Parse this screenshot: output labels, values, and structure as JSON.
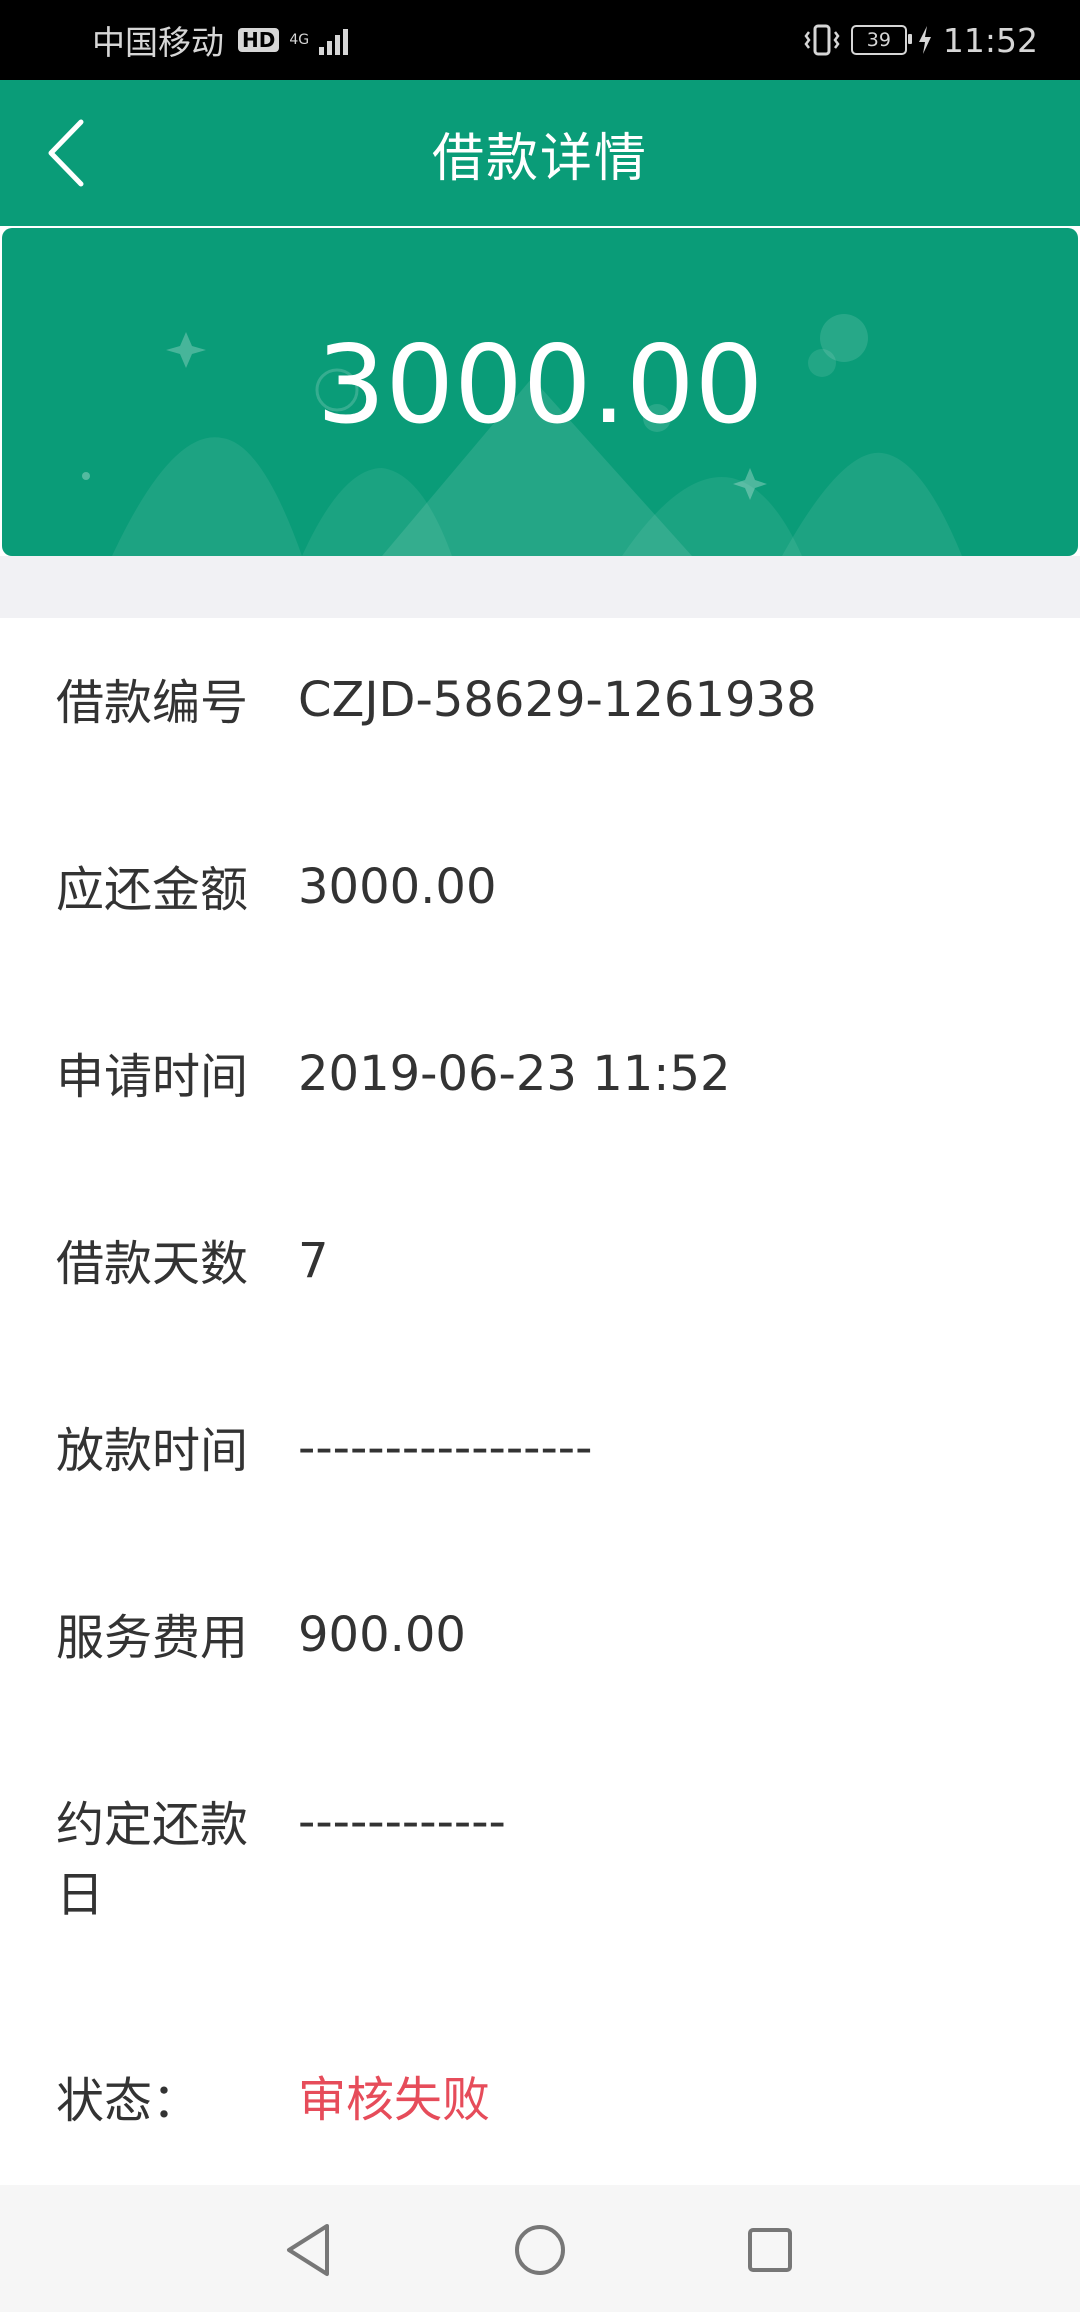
{
  "status_bar": {
    "carrier": "中国移动",
    "hd": "HD",
    "network": "4G",
    "battery": "39",
    "time": "11:52"
  },
  "header": {
    "title": "借款详情"
  },
  "banner": {
    "amount": "3000.00"
  },
  "details": [
    {
      "label": "借款编号",
      "value": "CZJD-58629-1261938"
    },
    {
      "label": "应还金额",
      "value": "3000.00"
    },
    {
      "label": "申请时间",
      "value": "2019-06-23 11:52"
    },
    {
      "label": "借款天数",
      "value": "7"
    },
    {
      "label": "放款时间",
      "value": "-----------------"
    },
    {
      "label": "服务费用",
      "value": "900.00"
    },
    {
      "label": "约定还款日",
      "value": "------------"
    },
    {
      "label": "状态：",
      "value": "审核失败"
    }
  ],
  "colors": {
    "brand": "#0a9c78",
    "status_failed": "#e64c5a",
    "text": "#333333"
  },
  "icons": {
    "back": "chevron-left-icon",
    "nav_back": "triangle-back-icon",
    "nav_home": "circle-home-icon",
    "nav_recent": "square-recent-icon"
  }
}
